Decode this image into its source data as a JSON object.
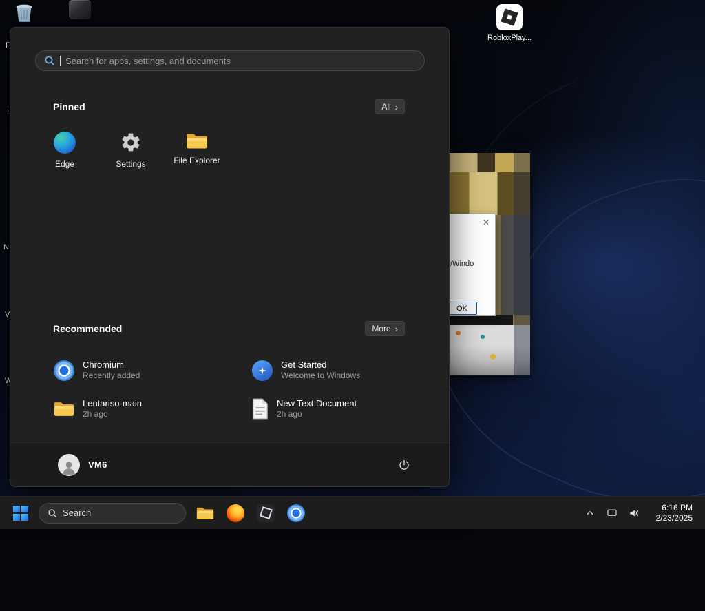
{
  "colors": {
    "accent": "#4cc2ff",
    "start_menu_bg": "#212121",
    "taskbar_bg": "#1d1d1d"
  },
  "icons": {
    "chevron_right": "›",
    "close": "✕"
  },
  "desktop": {
    "roblox_icon_label": "RobloxPlay...",
    "label_fragments": [
      "F",
      "I",
      "N",
      "V",
      "W"
    ]
  },
  "background_dialog": {
    "message": "/Windo",
    "ok_label": "OK"
  },
  "start_menu": {
    "search_placeholder": "Search for apps, settings, and documents",
    "pinned_title": "Pinned",
    "all_button_label": "All",
    "pinned_apps": [
      {
        "label": "Edge"
      },
      {
        "label": "Settings"
      },
      {
        "label": "File Explorer"
      }
    ],
    "recommended_title": "Recommended",
    "more_button_label": "More",
    "recommended_items": [
      {
        "title": "Chromium",
        "subtitle": "Recently added"
      },
      {
        "title": "Get Started",
        "subtitle": "Welcome to Windows"
      },
      {
        "title": "Lentariso-main",
        "subtitle": "2h ago"
      },
      {
        "title": "New Text Document",
        "subtitle": "2h ago"
      }
    ],
    "user_name": "VM6"
  },
  "taskbar": {
    "search_placeholder": "Search",
    "time": "6:16 PM",
    "date": "2/23/2025"
  }
}
